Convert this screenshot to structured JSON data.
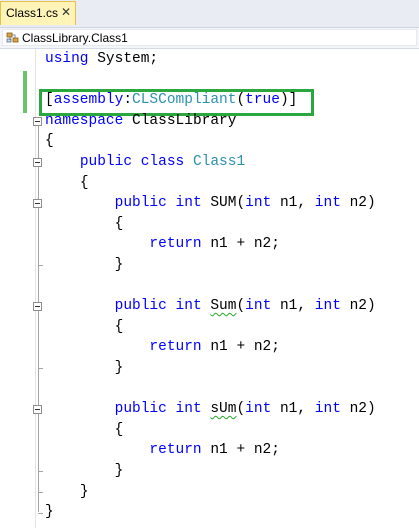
{
  "tab": {
    "label": "Class1.cs",
    "close_glyph": "✕",
    "active_color": "#fff4b8"
  },
  "navbar": {
    "icon": "class-icon",
    "label": "ClassLibrary.Class1"
  },
  "editor": {
    "lines": [
      {
        "indent": "",
        "tokens": [
          [
            "kw",
            "using"
          ],
          [
            "p",
            " System;"
          ]
        ]
      },
      {
        "indent": "",
        "tokens": []
      },
      {
        "indent": "",
        "tokens": [
          [
            "p",
            "["
          ],
          [
            "kw",
            "assembly"
          ],
          [
            "p",
            ":"
          ],
          [
            "ty",
            "CLSCompliant"
          ],
          [
            "p",
            "("
          ],
          [
            "kw",
            "true"
          ],
          [
            "p",
            ")]"
          ]
        ]
      },
      {
        "indent": "",
        "tokens": [
          [
            "kw",
            "namespace"
          ],
          [
            "p",
            " ClassLibrary"
          ]
        ]
      },
      {
        "indent": "",
        "tokens": [
          [
            "p",
            "{"
          ]
        ]
      },
      {
        "indent": "    ",
        "tokens": [
          [
            "kw",
            "public"
          ],
          [
            "p",
            " "
          ],
          [
            "kw",
            "class"
          ],
          [
            "p",
            " "
          ],
          [
            "ty",
            "Class1"
          ]
        ]
      },
      {
        "indent": "    ",
        "tokens": [
          [
            "p",
            "{"
          ]
        ]
      },
      {
        "indent": "        ",
        "tokens": [
          [
            "kw",
            "public"
          ],
          [
            "p",
            " "
          ],
          [
            "kw",
            "int"
          ],
          [
            "p",
            " SUM("
          ],
          [
            "kw",
            "int"
          ],
          [
            "p",
            " n1, "
          ],
          [
            "kw",
            "int"
          ],
          [
            "p",
            " n2)"
          ]
        ]
      },
      {
        "indent": "        ",
        "tokens": [
          [
            "p",
            "{"
          ]
        ]
      },
      {
        "indent": "            ",
        "tokens": [
          [
            "kw",
            "return"
          ],
          [
            "p",
            " n1 + n2;"
          ]
        ]
      },
      {
        "indent": "        ",
        "tokens": [
          [
            "p",
            "}"
          ]
        ]
      },
      {
        "indent": "",
        "tokens": []
      },
      {
        "indent": "        ",
        "tokens": [
          [
            "kw",
            "public"
          ],
          [
            "p",
            " "
          ],
          [
            "kw",
            "int"
          ],
          [
            "p",
            " "
          ],
          [
            "sq",
            "Sum"
          ],
          [
            "p",
            "("
          ],
          [
            "kw",
            "int"
          ],
          [
            "p",
            " n1, "
          ],
          [
            "kw",
            "int"
          ],
          [
            "p",
            " n2)"
          ]
        ]
      },
      {
        "indent": "        ",
        "tokens": [
          [
            "p",
            "{"
          ]
        ]
      },
      {
        "indent": "            ",
        "tokens": [
          [
            "kw",
            "return"
          ],
          [
            "p",
            " n1 + n2;"
          ]
        ]
      },
      {
        "indent": "        ",
        "tokens": [
          [
            "p",
            "}"
          ]
        ]
      },
      {
        "indent": "",
        "tokens": []
      },
      {
        "indent": "        ",
        "tokens": [
          [
            "kw",
            "public"
          ],
          [
            "p",
            " "
          ],
          [
            "kw",
            "int"
          ],
          [
            "p",
            " "
          ],
          [
            "sq",
            "sUm"
          ],
          [
            "p",
            "("
          ],
          [
            "kw",
            "int"
          ],
          [
            "p",
            " n1, "
          ],
          [
            "kw",
            "int"
          ],
          [
            "p",
            " n2)"
          ]
        ]
      },
      {
        "indent": "        ",
        "tokens": [
          [
            "p",
            "{"
          ]
        ]
      },
      {
        "indent": "            ",
        "tokens": [
          [
            "kw",
            "return"
          ],
          [
            "p",
            " n1 + n2;"
          ]
        ]
      },
      {
        "indent": "        ",
        "tokens": [
          [
            "p",
            "}"
          ]
        ]
      },
      {
        "indent": "    ",
        "tokens": [
          [
            "p",
            "}"
          ]
        ]
      },
      {
        "indent": "",
        "tokens": [
          [
            "p",
            "}"
          ]
        ]
      }
    ],
    "colors": {
      "keyword": "#0000ff",
      "type": "#2b91af",
      "highlight_border": "#2aa83e",
      "changed_bar": "#6cc36c"
    }
  }
}
